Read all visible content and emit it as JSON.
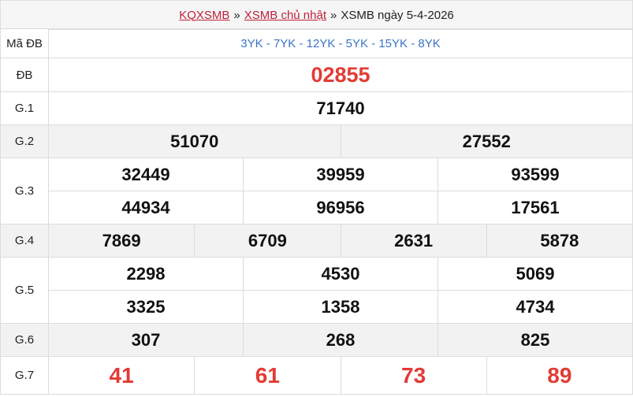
{
  "breadcrumb": {
    "home": "KQXSMB",
    "section": "XSMB chủ nhật",
    "current": "XSMB ngày 5-4-2026",
    "separator": "»"
  },
  "rows": {
    "ma_db": {
      "label": "Mã ĐB",
      "value": "3YK - 7YK - 12YK - 5YK - 15YK - 8YK"
    },
    "db": {
      "label": "ĐB",
      "values": [
        "02855"
      ]
    },
    "g1": {
      "label": "G.1",
      "values": [
        "71740"
      ]
    },
    "g2": {
      "label": "G.2",
      "values": [
        "51070",
        "27552"
      ]
    },
    "g3": {
      "label": "G.3",
      "values": [
        "32449",
        "39959",
        "93599",
        "44934",
        "96956",
        "17561"
      ]
    },
    "g4": {
      "label": "G.4",
      "values": [
        "7869",
        "6709",
        "2631",
        "5878"
      ]
    },
    "g5": {
      "label": "G.5",
      "values": [
        "2298",
        "4530",
        "5069",
        "3325",
        "1358",
        "4734"
      ]
    },
    "g6": {
      "label": "G.6",
      "values": [
        "307",
        "268",
        "825"
      ]
    },
    "g7": {
      "label": "G.7",
      "values": [
        "41",
        "61",
        "73",
        "89"
      ]
    }
  },
  "colors": {
    "accent_red": "#e23b35",
    "link_red": "#c0213a",
    "code_blue": "#3a73c7",
    "alt_row": "#f2f2f2"
  }
}
